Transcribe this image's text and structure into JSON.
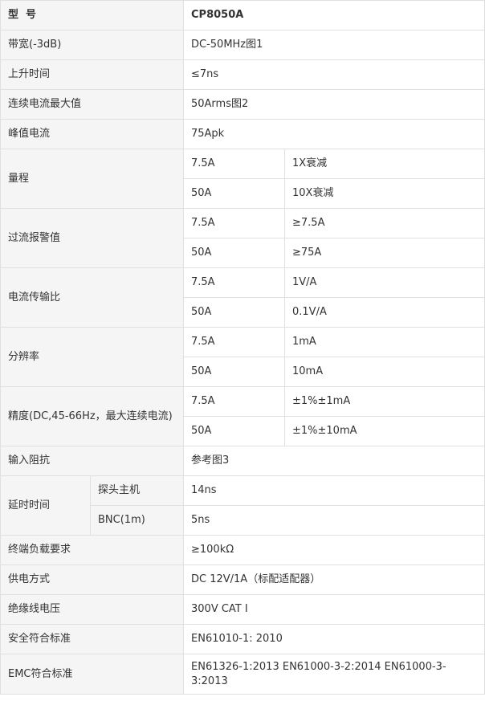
{
  "header": {
    "label": "型  号",
    "value": "CP8050A"
  },
  "rows": {
    "bandwidth": {
      "label": "带宽(-3dB)",
      "value": "DC-50MHz图1"
    },
    "rise_time": {
      "label": "上升时间",
      "value": "≤7ns"
    },
    "cont_current": {
      "label": "连续电流最大值",
      "value": "50Arms图2"
    },
    "peak_current": {
      "label": "峰值电流",
      "value": "75Apk"
    },
    "range": {
      "label": "量程",
      "sub": [
        {
          "a": "7.5A",
          "b": "1X衰减"
        },
        {
          "a": "50A",
          "b": "10X衰减"
        }
      ]
    },
    "overcurrent": {
      "label": "过流报警值",
      "sub": [
        {
          "a": "7.5A",
          "b": "≥7.5A"
        },
        {
          "a": "50A",
          "b": "≥75A"
        }
      ]
    },
    "transfer_ratio": {
      "label": "电流传输比",
      "sub": [
        {
          "a": "7.5A",
          "b": "1V/A"
        },
        {
          "a": "50A",
          "b": "0.1V/A"
        }
      ]
    },
    "resolution": {
      "label": "分辨率",
      "sub": [
        {
          "a": "7.5A",
          "b": "1mA"
        },
        {
          "a": "50A",
          "b": "10mA"
        }
      ]
    },
    "accuracy": {
      "label": "精度(DC,45-66Hz，最大连续电流)",
      "sub": [
        {
          "a": "7.5A",
          "b": "±1%±1mA"
        },
        {
          "a": "50A",
          "b": "±1%±10mA"
        }
      ]
    },
    "input_impedance": {
      "label": "输入阻抗",
      "value": "参考图3"
    },
    "delay": {
      "label": "延时时间",
      "sub": [
        {
          "a": "探头主机",
          "b": "14ns"
        },
        {
          "a": "BNC(1m)",
          "b": "5ns"
        }
      ]
    },
    "terminal_load": {
      "label": "终端负载要求",
      "value": "≥100kΩ"
    },
    "power": {
      "label": "供电方式",
      "value": "DC 12V/1A（标配适配器）"
    },
    "insulation": {
      "label": "绝缘线电压",
      "value": "300V CAT I"
    },
    "safety": {
      "label": "安全符合标准",
      "value": "EN61010-1: 2010"
    },
    "emc": {
      "label": "EMC符合标准",
      "value": "EN61326-1:2013  EN61000-3-2:2014  EN61000-3-3:2013"
    }
  }
}
